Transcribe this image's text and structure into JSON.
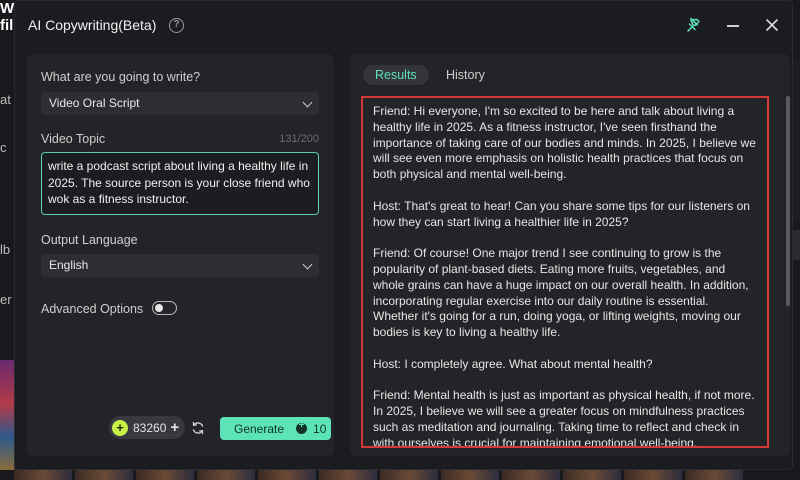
{
  "background": {
    "brand_text": "Wondershare\nfil",
    "side_letters": [
      "at",
      "c",
      "lb",
      "er"
    ]
  },
  "dialog": {
    "title": "AI Copywriting(Beta)",
    "help_icon": "?"
  },
  "left": {
    "write_label": "What are you going to write?",
    "write_value": "Video Oral Script",
    "topic_label": "Video Topic",
    "topic_counter": "131/200",
    "topic_value": "write a podcast script about living a healthy life in 2025. The source person is your close friend who wok as a fitness instructor.",
    "language_label": "Output Language",
    "language_value": "English",
    "advanced_label": "Advanced Options",
    "advanced_enabled": false,
    "credits": "83260",
    "generate_label": "Generate",
    "generate_cost": "10"
  },
  "right": {
    "tabs": [
      {
        "label": "Results",
        "active": true
      },
      {
        "label": "History",
        "active": false
      }
    ],
    "result_text": "Friend: Hi everyone, I'm so excited to be here and talk about living a healthy life in 2025. As a fitness instructor, I've seen firsthand the importance of taking care of our bodies and minds. In 2025, I believe we will see even more emphasis on holistic health practices that focus on both physical and mental well-being.\n\nHost: That's great to hear! Can you share some tips for our listeners on how they can start living a healthier life in 2025?\n\nFriend: Of course! One major trend I see continuing to grow is the popularity of plant-based diets. Eating more fruits, vegetables, and whole grains can have a huge impact on our overall health. In addition, incorporating regular exercise into our daily routine is essential. Whether it's going for a run, doing yoga, or lifting weights, moving our bodies is key to living a healthy life.\n\nHost: I completely agree. What about mental health?\n\nFriend: Mental health is just as important as physical health, if not more. In 2025, I believe we will see a greater focus on mindfulness practices such as meditation and journaling. Taking time to reflect and check in with ourselves is crucial for maintaining emotional well-being."
  },
  "colors": {
    "accent": "#5ce3b8",
    "highlight_border": "#d23a3a",
    "dialog_bg": "#1b1c20",
    "panel_bg": "#232428"
  }
}
